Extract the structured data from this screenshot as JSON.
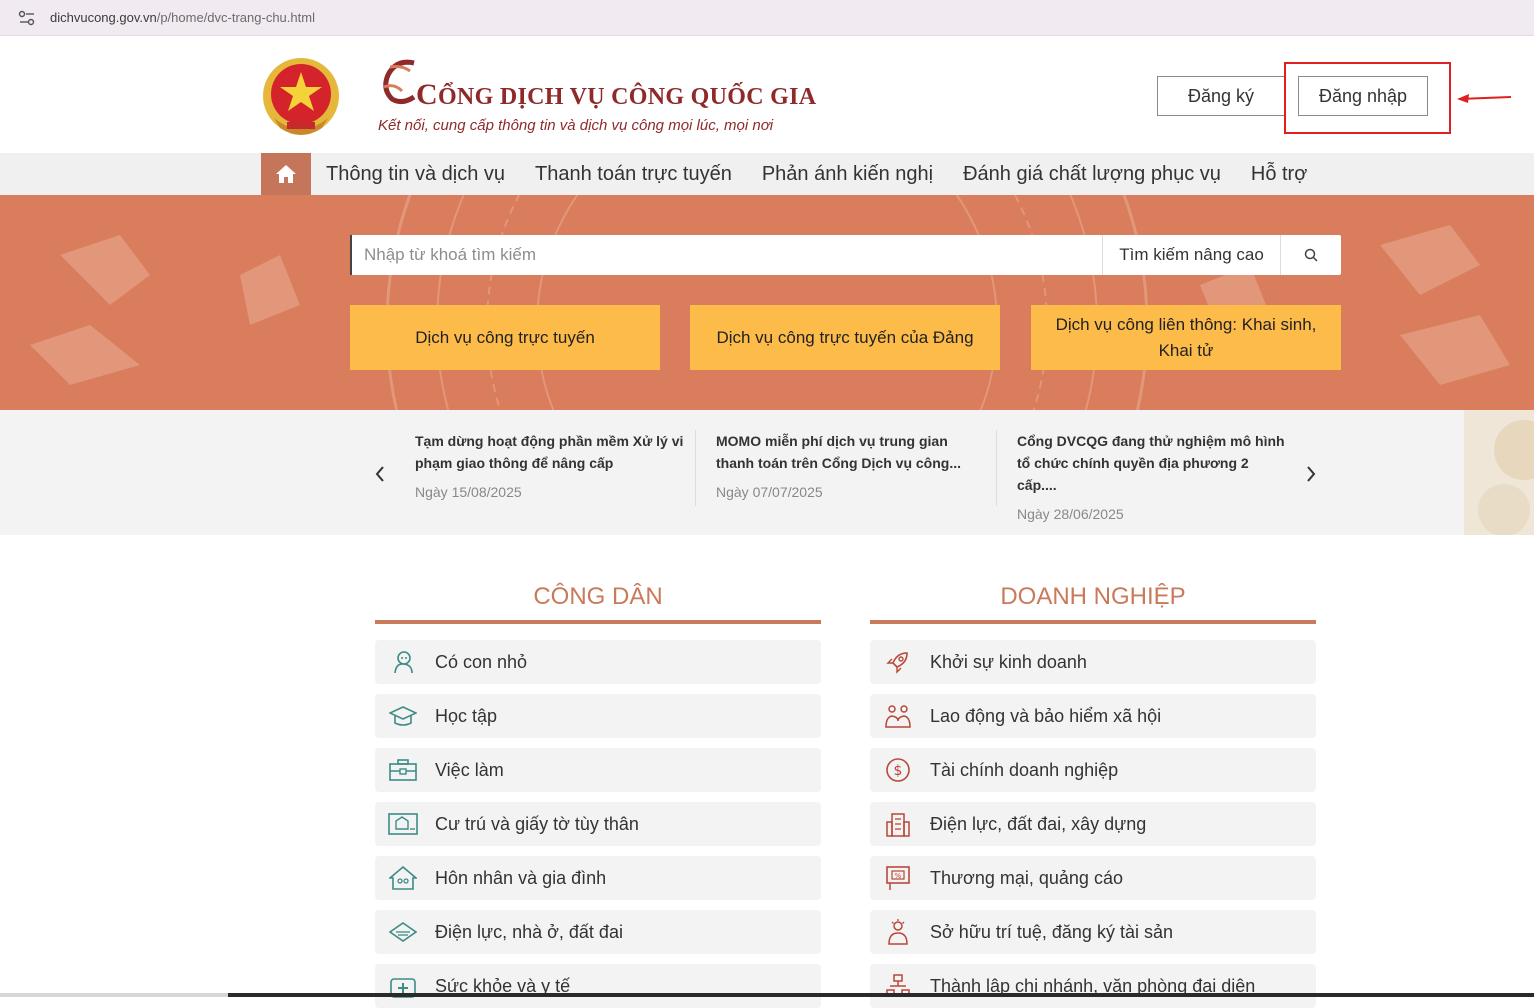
{
  "browser": {
    "url_host": "dichvucong.gov.vn",
    "url_path": "/p/home/dvc-trang-chu.html"
  },
  "header": {
    "title_first_letter": "C",
    "title_rest": "ỔNG DỊCH VỤ CÔNG QUỐC GIA",
    "slogan": "Kết nối, cung cấp thông tin và dịch vụ công mọi lúc, mọi nơi",
    "register_label": "Đăng ký",
    "login_label": "Đăng nhập"
  },
  "nav": {
    "items": [
      {
        "label": "Thông tin và dịch vụ"
      },
      {
        "label": "Thanh toán trực tuyến"
      },
      {
        "label": "Phản ánh kiến nghị"
      },
      {
        "label": "Đánh giá chất lượng phục vụ"
      },
      {
        "label": "Hỗ trợ"
      }
    ]
  },
  "search": {
    "placeholder": "Nhập từ khoá tìm kiếm",
    "advanced_label": "Tìm kiếm nâng cao"
  },
  "hero_buttons": [
    {
      "label": "Dịch vụ công trực tuyến"
    },
    {
      "label": "Dịch vụ công trực tuyến của Đảng"
    },
    {
      "label": "Dịch vụ công liên thông: Khai sinh, Khai tử"
    }
  ],
  "news": [
    {
      "title": "Tạm dừng hoạt động phần mềm Xử lý vi phạm giao thông để nâng cấp",
      "date": "Ngày 15/08/2025"
    },
    {
      "title": "MOMO miễn phí dịch vụ trung gian thanh toán trên Cổng Dịch vụ công...",
      "date": "Ngày 07/07/2025"
    },
    {
      "title": "Cổng DVCQG đang thử nghiệm mô hình tổ chức chính quyền địa phương 2 cấp....",
      "date": "Ngày 28/06/2025"
    }
  ],
  "citizen": {
    "title": "CÔNG DÂN",
    "items": [
      {
        "label": "Có con nhỏ",
        "icon": "baby-icon"
      },
      {
        "label": "Học tập",
        "icon": "graduation-cap-icon"
      },
      {
        "label": "Việc làm",
        "icon": "briefcase-icon"
      },
      {
        "label": "Cư trú và giấy tờ tùy thân",
        "icon": "id-card-icon"
      },
      {
        "label": "Hôn nhân và gia đình",
        "icon": "family-house-icon"
      },
      {
        "label": "Điện lực, nhà ở, đất đai",
        "icon": "land-icon"
      },
      {
        "label": "Sức khỏe và y tế",
        "icon": "medical-kit-icon"
      }
    ]
  },
  "business": {
    "title": "DOANH NGHIỆP",
    "items": [
      {
        "label": "Khởi sự kinh doanh",
        "icon": "rocket-icon"
      },
      {
        "label": "Lao động và bảo hiểm xã hội",
        "icon": "workers-icon"
      },
      {
        "label": "Tài chính doanh nghiệp",
        "icon": "dollar-icon"
      },
      {
        "label": "Điện lực, đất đai, xây dựng",
        "icon": "building-icon"
      },
      {
        "label": "Thương mại, quảng cáo",
        "icon": "billboard-icon"
      },
      {
        "label": "Sở hữu trí tuệ, đăng ký tài sản",
        "icon": "idea-person-icon"
      },
      {
        "label": "Thành lập chi nhánh, văn phòng đại diện",
        "icon": "org-chart-icon"
      }
    ]
  },
  "colors": {
    "accent": "#c97a5a",
    "hero_bg": "#d97d5c",
    "hero_button": "#fdbb4a",
    "title_red": "#8f2a2a",
    "icon_teal": "#3d8c86",
    "icon_red": "#b8483a"
  }
}
